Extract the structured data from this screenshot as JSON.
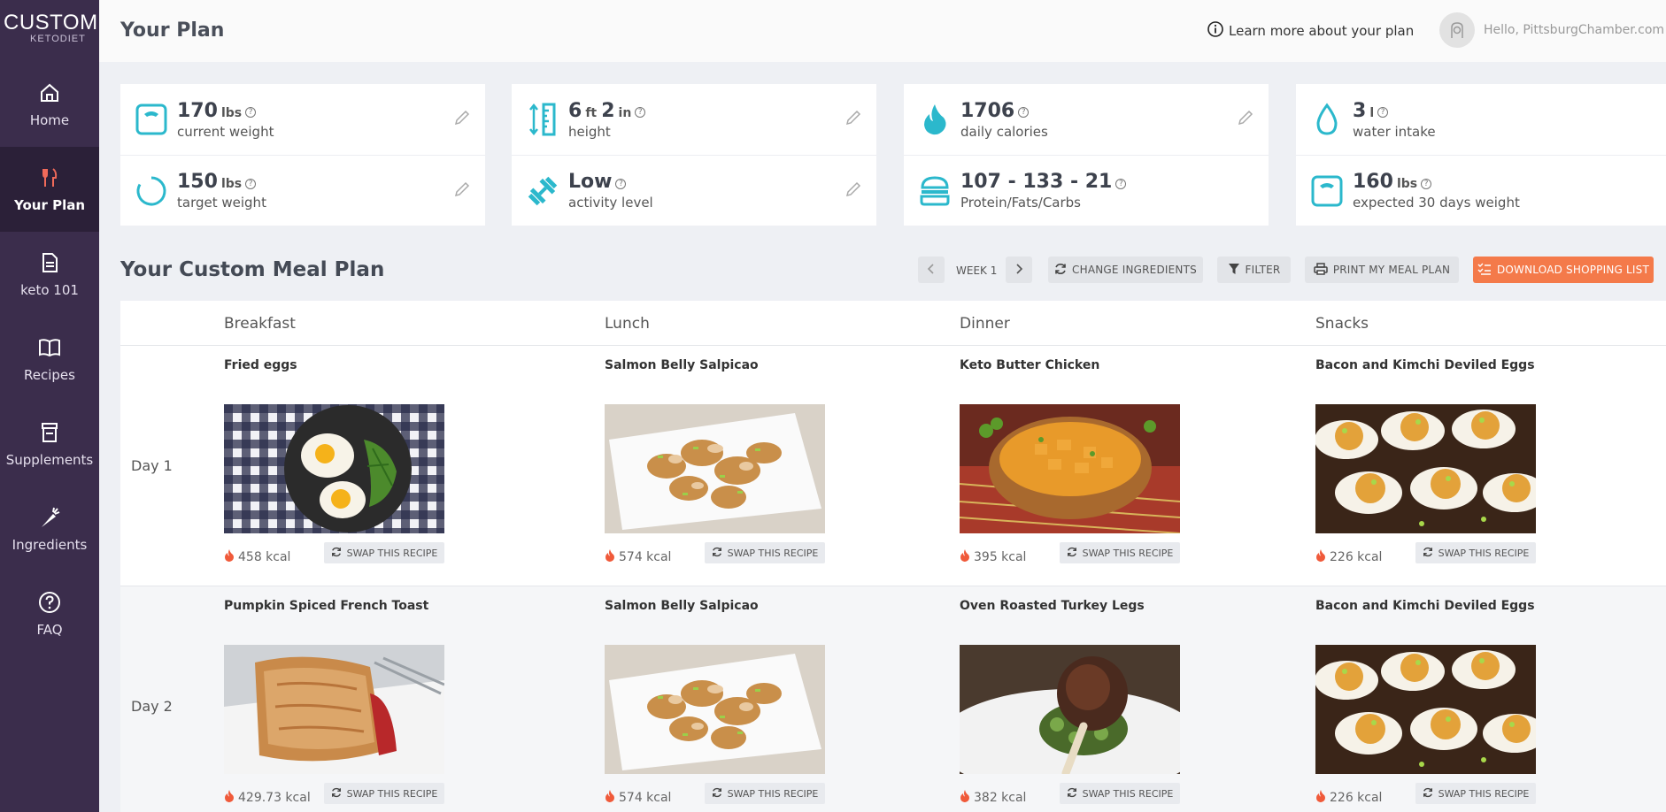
{
  "brand": {
    "logo_main": "CUSTOM",
    "logo_sub": "KETODIET"
  },
  "sidebar": {
    "items": [
      {
        "label": "Home",
        "icon": "home-icon"
      },
      {
        "label": "Your Plan",
        "icon": "fork-knife-icon",
        "active": true
      },
      {
        "label": "keto 101",
        "icon": "document-icon"
      },
      {
        "label": "Recipes",
        "icon": "book-icon"
      },
      {
        "label": "Supplements",
        "icon": "supplement-jar-icon"
      },
      {
        "label": "Ingredients",
        "icon": "carrot-icon"
      },
      {
        "label": "FAQ",
        "icon": "question-icon"
      }
    ]
  },
  "header": {
    "title": "Your Plan",
    "learn_more": "Learn more about your plan",
    "greeting": "Hello, PittsburgChamber.com"
  },
  "stats": {
    "current_weight": {
      "value": "170",
      "unit": "lbs",
      "label": "current weight"
    },
    "target_weight": {
      "value": "150",
      "unit": "lbs",
      "label": "target weight"
    },
    "height": {
      "feet": "6",
      "ft_unit": "ft",
      "inches": "2",
      "in_unit": "in",
      "label": "height"
    },
    "activity": {
      "value": "Low",
      "label": "activity level"
    },
    "calories": {
      "value": "1706",
      "label": "daily calories"
    },
    "macros": {
      "value": "107 - 133 - 21",
      "label": "Protein/Fats/Carbs"
    },
    "water": {
      "value": "3",
      "unit": "l",
      "label": "water intake"
    },
    "expected": {
      "value": "160",
      "unit": "lbs",
      "label": "expected 30 days weight"
    }
  },
  "meal_plan": {
    "title": "Your Custom Meal Plan",
    "week_label": "WEEK 1",
    "change_ingredients": "CHANGE INGREDIENTS",
    "filter": "FILTER",
    "print": "PRINT MY MEAL PLAN",
    "download": "DOWNLOAD SHOPPING LIST",
    "columns": [
      "Breakfast",
      "Lunch",
      "Dinner",
      "Snacks"
    ],
    "swap_label": "SWAP THIS RECIPE",
    "days": [
      {
        "label": "Day 1",
        "meals": [
          {
            "name": "Fried eggs",
            "kcal": "458 kcal"
          },
          {
            "name": "Salmon Belly Salpicao",
            "kcal": "574 kcal"
          },
          {
            "name": "Keto Butter Chicken",
            "kcal": "395 kcal"
          },
          {
            "name": "Bacon and Kimchi Deviled Eggs",
            "kcal": "226 kcal"
          }
        ]
      },
      {
        "label": "Day 2",
        "meals": [
          {
            "name": "Pumpkin Spiced French Toast",
            "kcal": "429.73 kcal"
          },
          {
            "name": "Salmon Belly Salpicao",
            "kcal": "574 kcal"
          },
          {
            "name": "Oven Roasted Turkey Legs",
            "kcal": "382 kcal"
          },
          {
            "name": "Bacon and Kimchi Deviled Eggs",
            "kcal": "226 kcal"
          }
        ]
      }
    ]
  },
  "colors": {
    "sidebar": "#3b2d4c",
    "accent_teal": "#2bb8cc",
    "accent_orange": "#f47a4a",
    "flame": "#f05a3a"
  }
}
